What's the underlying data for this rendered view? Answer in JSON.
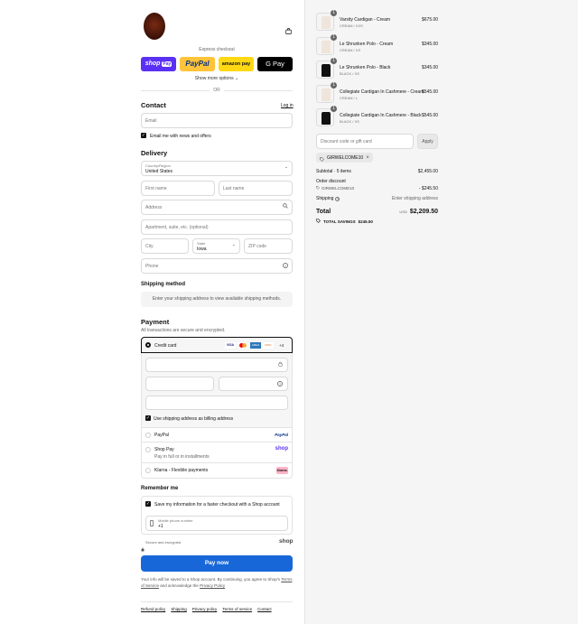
{
  "express": {
    "label": "Express checkout",
    "shop": "shop",
    "shop_pay": "Pay",
    "paypal": "PayPal",
    "amazon": "amazon pay",
    "gpay": "G Pay",
    "more": "Show more options",
    "or": "OR"
  },
  "contact": {
    "title": "Contact",
    "login": "Log in",
    "email_placeholder": "Email",
    "news": "Email me with news and offers"
  },
  "delivery": {
    "title": "Delivery",
    "country_label": "Country/Region",
    "country": "United States",
    "first": "First name",
    "last": "Last name",
    "address": "Address",
    "apt": "Apartment, suite, etc. (optional)",
    "city": "City",
    "state_label": "State",
    "state": "Iowa",
    "zip": "ZIP code",
    "phone": "Phone"
  },
  "shipping": {
    "title": "Shipping method",
    "msg": "Enter your shipping address to view available shipping methods."
  },
  "payment": {
    "title": "Payment",
    "sub": "All transactions are secure and encrypted.",
    "cc": "Credit card",
    "cards": [
      "VISA",
      "MC",
      "AMEX",
      "DISC"
    ],
    "more": "+4",
    "billing": "Use shipping address as billing address",
    "paypal": "PayPal",
    "paypal_logo": "PayPal",
    "shoppay": "Shop Pay",
    "shoppay_sub": "Pay in full or in installments",
    "shop_logo": "shop",
    "klarna": "Klarna - Flexible payments",
    "klarna_logo": "Klarna."
  },
  "remember": {
    "title": "Remember me",
    "save": "Save my information for a faster checkout with a Shop account",
    "mobile_label": "Mobile phone number",
    "mobile": "+1",
    "secure": "Secure and encrypted",
    "shop_logo": "shop"
  },
  "pay_now": "Pay now",
  "legal": {
    "pre": "Your info will be saved to a Shop account. By continuing, you agree to Shop's",
    "terms": "Terms of Service",
    "mid": "and acknowledge the",
    "privacy": "Privacy Policy"
  },
  "footer": [
    "Refund policy",
    "Shipping",
    "Privacy policy",
    "Terms of service",
    "Contact"
  ],
  "cart": {
    "items": [
      {
        "qty": "1",
        "name": "Varsity Cardigan - Cream",
        "variant": "CREAM / XXS",
        "price": "$675.00",
        "color": "#efe5da"
      },
      {
        "qty": "1",
        "name": "Le Shrunken Polo - Cream",
        "variant": "CREAM / XS",
        "price": "$345.00",
        "color": "#efe5da"
      },
      {
        "qty": "1",
        "name": "Le Shrunken Polo - Black",
        "variant": "BLACK / XS",
        "price": "$345.00",
        "color": "#111111"
      },
      {
        "qty": "1",
        "name": "Collegiate Cardigan In Cashmere - Cream",
        "variant": "CREAM / L",
        "price": "$545.00",
        "color": "#efe5da"
      },
      {
        "qty": "1",
        "name": "Collegiate Cardigan In Cashmere - Black",
        "variant": "BLACK / XS",
        "price": "$545.00",
        "color": "#111111"
      }
    ],
    "discount_placeholder": "Discount code or gift card",
    "apply": "Apply",
    "code": "GIRWELCOME10",
    "subtotal_label": "Subtotal · 5 items",
    "subtotal": "$2,455.00",
    "order_discount": "Order discount",
    "code_line": "GIRWELCOME10",
    "discount": "- $245.50",
    "shipping_label": "Shipping",
    "shipping_val": "Enter shipping address",
    "total_label": "Total",
    "currency": "USD",
    "total": "$2,209.50",
    "savings_label": "TOTAL SAVINGS",
    "savings": "$245.50"
  }
}
